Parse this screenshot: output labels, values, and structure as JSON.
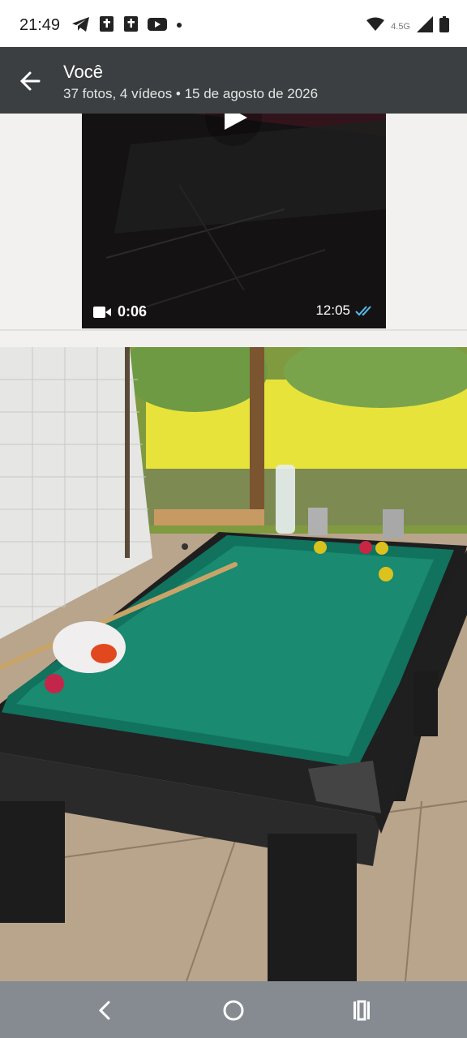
{
  "status_bar": {
    "time": "21:49",
    "left_icons": [
      "telegram-icon",
      "bible-app-icon",
      "bible-app-icon",
      "youtube-icon",
      "dot-icon"
    ],
    "network": "4.5G",
    "right_icons": [
      "wifi-icon",
      "signal-icon",
      "battery-icon"
    ]
  },
  "header": {
    "back_icon": "arrow-left-icon",
    "title": "Você",
    "subtitle": "37 fotos, 4 vídeos  •  15 de agosto de 2026"
  },
  "video": {
    "duration": "0:06",
    "time": "12:05",
    "status": "read-double-check",
    "check_color": "#53bdeb"
  },
  "nav_bar": {
    "buttons": [
      "back-nav-icon",
      "home-nav-icon",
      "recents-nav-icon"
    ]
  }
}
